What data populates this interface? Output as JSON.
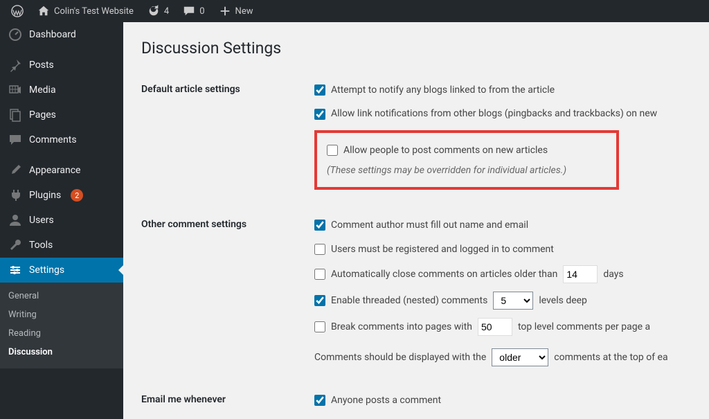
{
  "adminbar": {
    "site_title": "Colin's Test Website",
    "updates_count": "4",
    "comments_count": "0",
    "new_label": "New"
  },
  "sidebar": {
    "items": {
      "dashboard": "Dashboard",
      "posts": "Posts",
      "media": "Media",
      "pages": "Pages",
      "comments": "Comments",
      "appearance": "Appearance",
      "plugins": "Plugins",
      "plugins_badge": "2",
      "users": "Users",
      "tools": "Tools",
      "settings": "Settings"
    },
    "settings_submenu": {
      "general": "General",
      "writing": "Writing",
      "reading": "Reading",
      "discussion": "Discussion"
    }
  },
  "page": {
    "title": "Discussion Settings",
    "sections": {
      "default_article": "Default article settings",
      "other_comment": "Other comment settings",
      "email_me": "Email me whenever"
    },
    "options": {
      "notify_linked": "Attempt to notify any blogs linked to from the article",
      "allow_pingbacks": "Allow link notifications from other blogs (pingbacks and trackbacks) on new",
      "allow_comments": "Allow people to post comments on new articles",
      "override_note": "(These settings may be overridden for individual articles.)",
      "author_name": "Comment author must fill out name and email",
      "must_register": "Users must be registered and logged in to comment",
      "auto_close_pre": "Automatically close comments on articles older than",
      "auto_close_days_value": "14",
      "auto_close_post": "days",
      "threaded_pre": "Enable threaded (nested) comments",
      "threaded_levels_value": "5",
      "threaded_post": "levels deep",
      "paginate_pre": "Break comments into pages with",
      "paginate_value": "50",
      "paginate_post": "top level comments per page a",
      "order_pre": "Comments should be displayed with the",
      "order_value": "older",
      "order_post": "comments at the top of ea",
      "anyone_posts": "Anyone posts a comment"
    }
  }
}
